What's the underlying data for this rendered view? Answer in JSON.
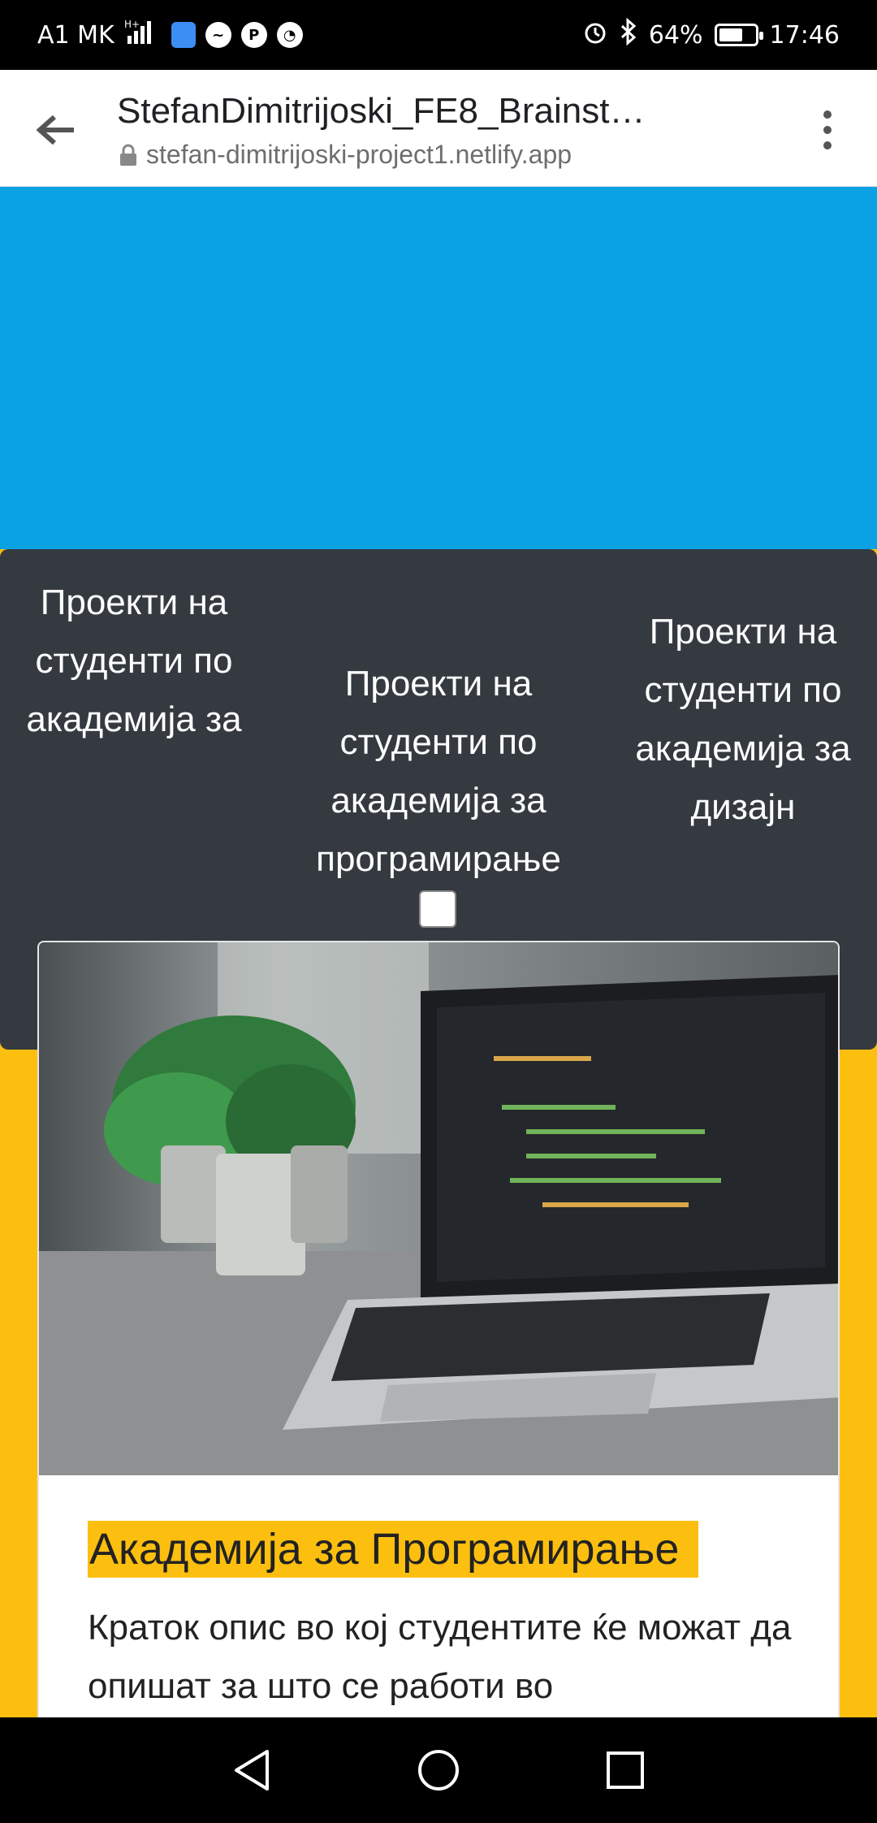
{
  "status_bar": {
    "carrier": "A1 MK",
    "battery_percent": "64%",
    "battery_level": 0.64,
    "time": "17:46",
    "icons": [
      "signal-icon",
      "shield-app-icon",
      "messenger-icon",
      "pinterest-icon",
      "chat-app-icon",
      "alarm-icon",
      "bluetooth-icon",
      "battery-icon"
    ]
  },
  "browser": {
    "title": "StefanDimitrijoski_FE8_Brainst…",
    "url": "stefan-dimitrijoski-project1.netlify.app"
  },
  "nav": {
    "items": [
      "Проекти на студенти по академија за",
      "Проекти на студенти по академија за програмирање",
      "Проекти на студенти по академија за дизајн"
    ]
  },
  "card": {
    "title": "Академија за Програмирање",
    "text": "Краток опис во кој студентите ќе можат да опишат за што се работи во"
  },
  "colors": {
    "hero": "#0aa2e3",
    "nav_bg": "#343a40",
    "page_bg": "#fcbf0f",
    "highlight": "#fcbf0f"
  }
}
